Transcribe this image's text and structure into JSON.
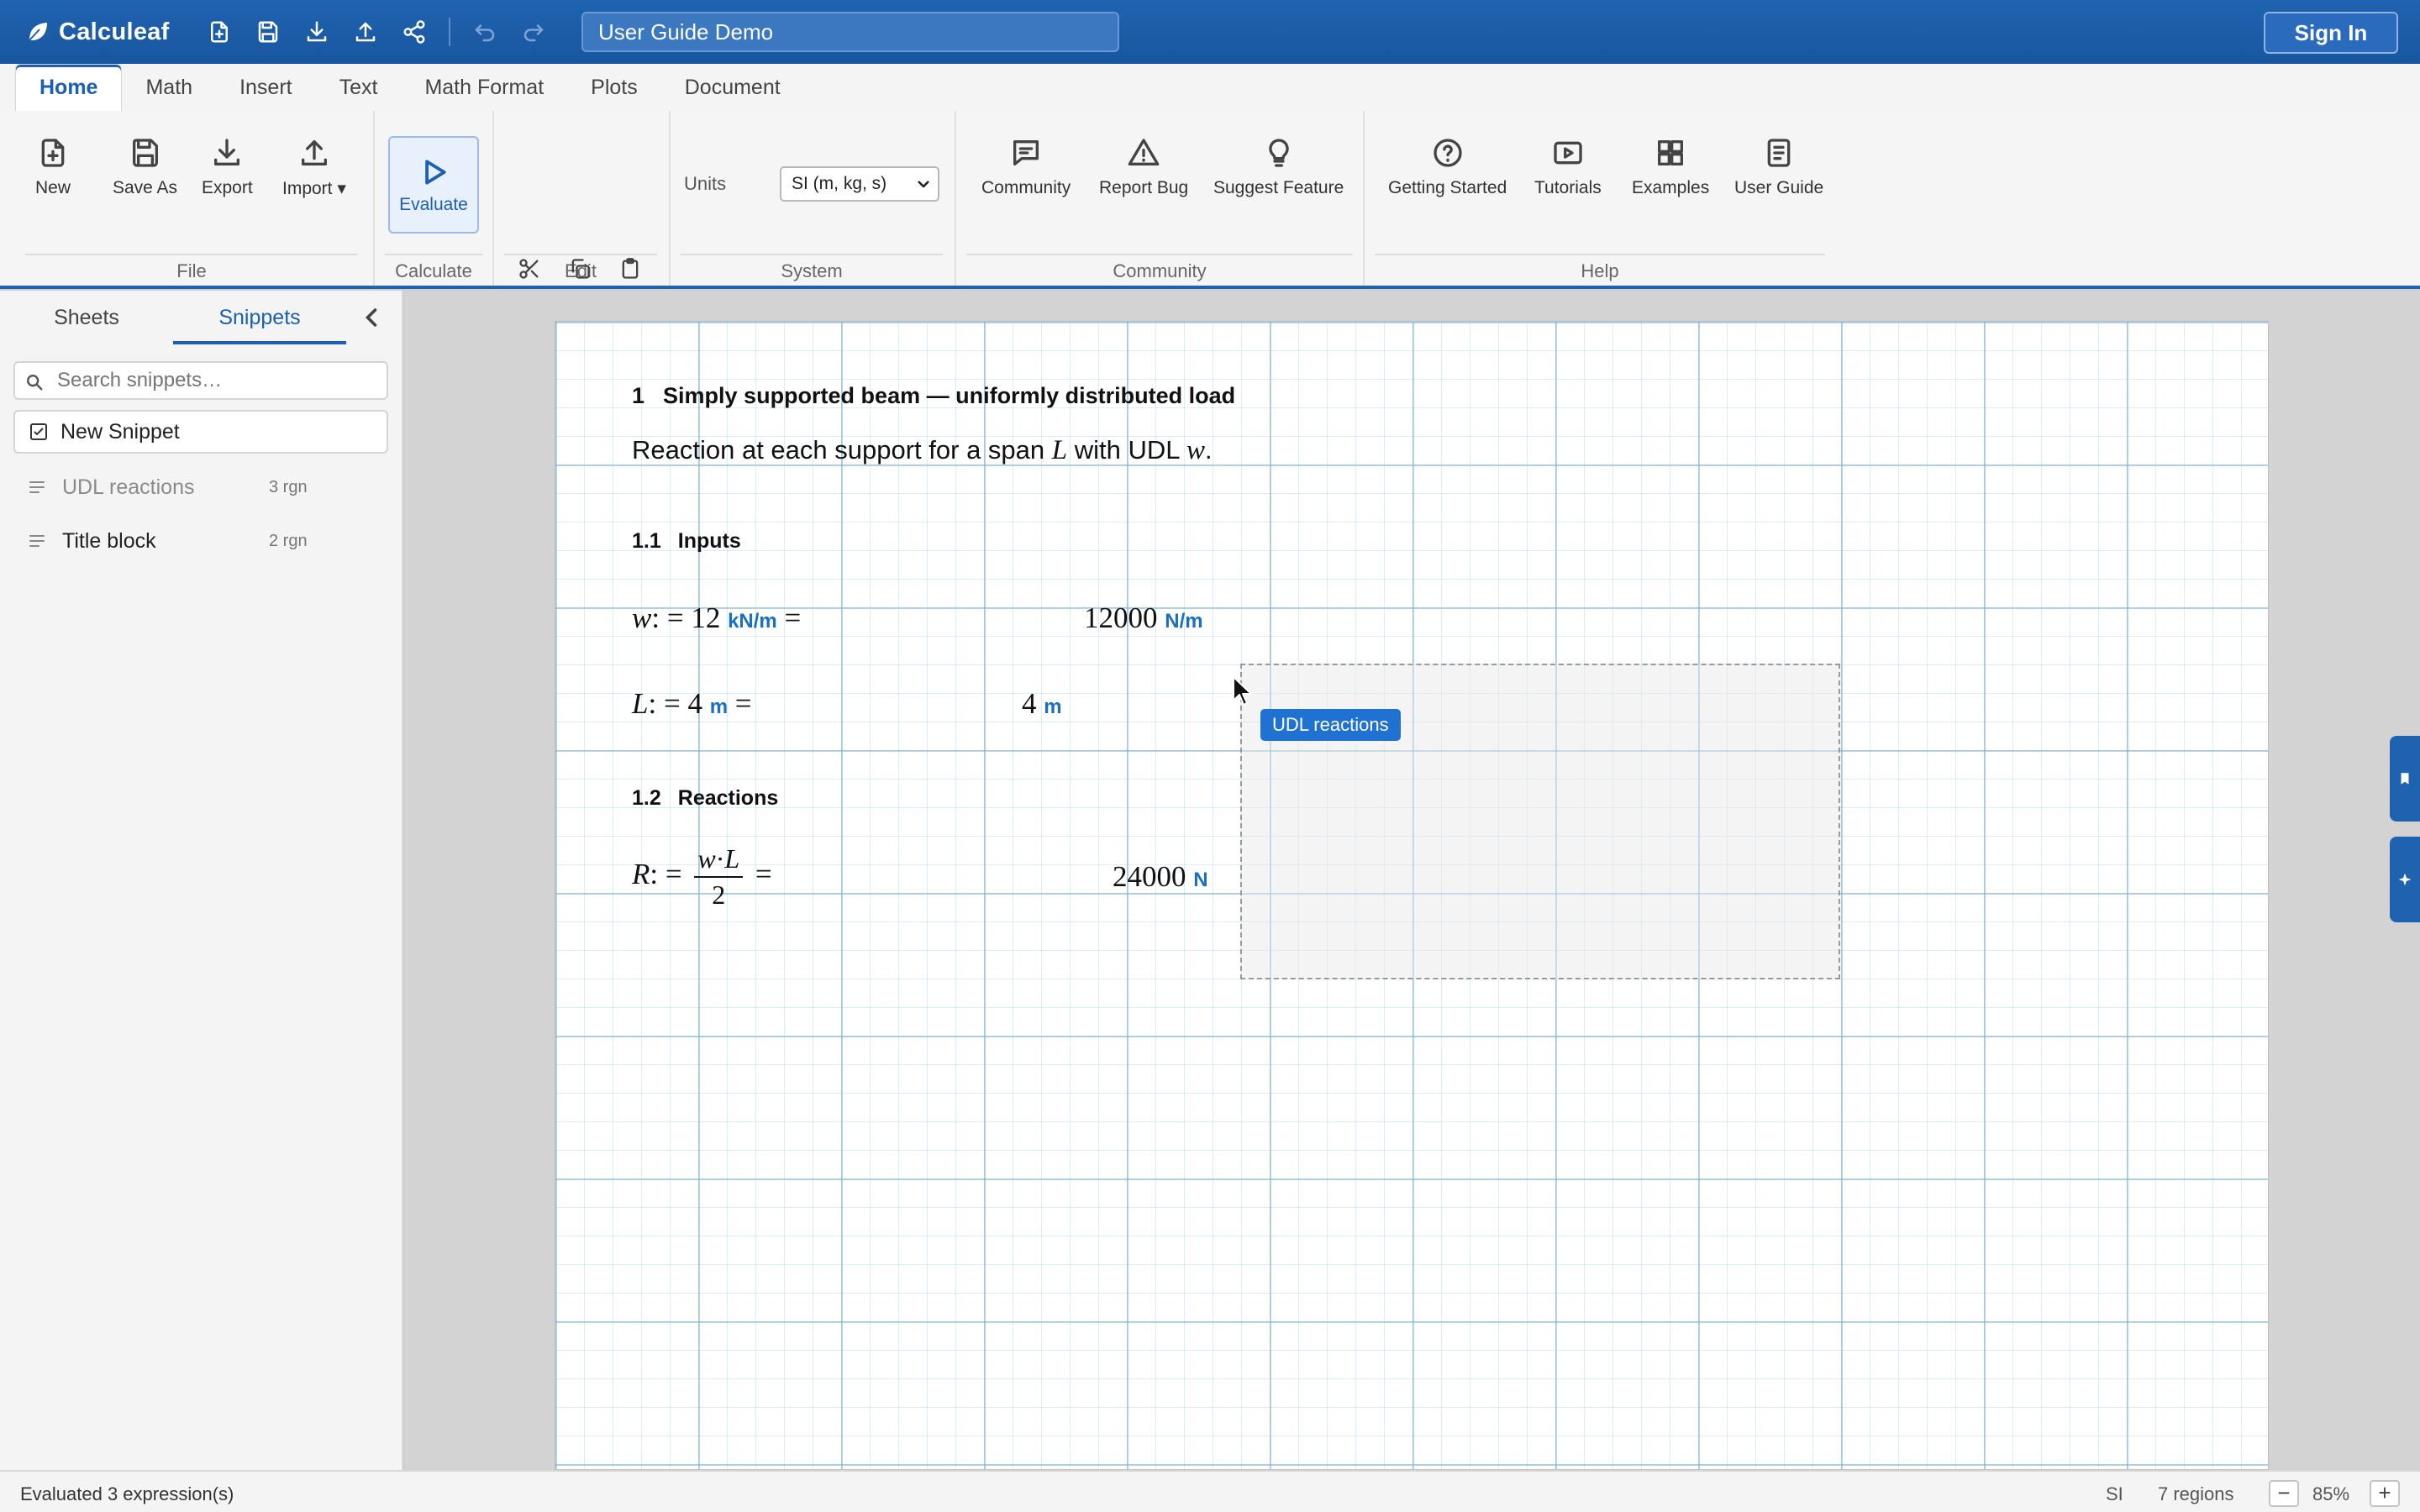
{
  "app": {
    "name": "Calculeaf"
  },
  "titlebar": {
    "doc_title": "User Guide Demo",
    "sign_in": "Sign In",
    "icons": [
      "new-file-icon",
      "save-icon",
      "download-icon",
      "upload-icon",
      "share-icon",
      "undo-icon",
      "redo-icon"
    ]
  },
  "ribbon_tabs": [
    "Home",
    "Math",
    "Insert",
    "Text",
    "Math Format",
    "Plots",
    "Document"
  ],
  "ribbon": {
    "file": {
      "label": "File",
      "new": "New",
      "save_as": "Save As",
      "export": "Export",
      "import": "Import ▾"
    },
    "calculate": {
      "label": "Calculate",
      "evaluate": "Evaluate"
    },
    "edit": {
      "label": "Edit"
    },
    "system": {
      "label": "System",
      "units_label": "Units",
      "units_value": "SI (m, kg, s)"
    },
    "community": {
      "label": "Community",
      "community": "Community",
      "report_bug": "Report Bug",
      "suggest_feature": "Suggest Feature"
    },
    "help": {
      "label": "Help",
      "getting_started": "Getting Started",
      "tutorials": "Tutorials",
      "examples": "Examples",
      "user_guide": "User Guide"
    }
  },
  "sidebar": {
    "tabs": [
      "Sheets",
      "Snippets"
    ],
    "active_tab": "Snippets",
    "search_placeholder": "Search snippets…",
    "new_snippet": "New Snippet",
    "snippets": [
      {
        "name": "UDL reactions",
        "count": "3 rgn"
      },
      {
        "name": "Title block",
        "count": "2 rgn"
      }
    ]
  },
  "sheet": {
    "section": {
      "num": "1",
      "title": "Simply supported beam — uniformly distributed load"
    },
    "para": {
      "pre": "Reaction at each support for a span ",
      "var1": "L",
      "mid": " with UDL ",
      "var2": "w",
      "post": "."
    },
    "sub1": {
      "num": "1.1",
      "title": "Inputs"
    },
    "sub2": {
      "num": "1.2",
      "title": "Reactions"
    },
    "eq_w": {
      "var": "w",
      "assign": ": = ",
      "value": "12",
      "unit": "kN/m",
      "eq": " =",
      "result": "12000",
      "result_unit": "N/m"
    },
    "eq_L": {
      "var": "L",
      "assign": ": = ",
      "value": "4",
      "unit": "m",
      "eq": " =",
      "result": "4",
      "result_unit": "m"
    },
    "eq_R": {
      "var": "R",
      "assign": ": = ",
      "num_a": "w",
      "dot": "·",
      "num_b": "L",
      "den": "2",
      "eq": "=",
      "result": "24000",
      "result_unit": "N"
    },
    "drop_tag": "UDL reactions"
  },
  "status": {
    "message": "Evaluated 3 expression(s)",
    "units": "SI",
    "regions": "7 regions",
    "zoom": "85%"
  },
  "colors": {
    "brand": "#1f63b0",
    "accent": "#1a5fb4",
    "unit_blue": "#1a6fc4"
  }
}
